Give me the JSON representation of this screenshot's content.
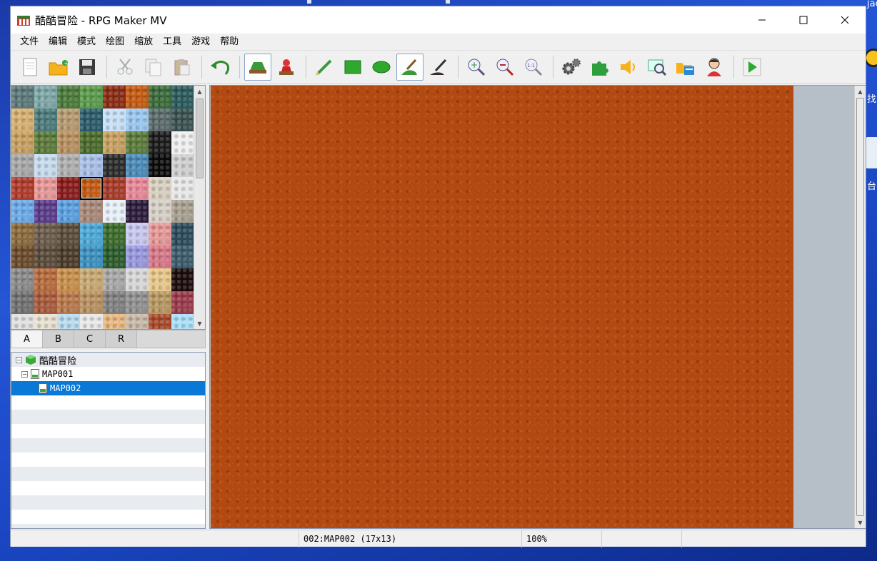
{
  "window": {
    "title": "酷酷冒险 - RPG Maker MV"
  },
  "window_controls": {
    "minimize": "—",
    "maximize": "☐",
    "close": "✕"
  },
  "menu": [
    "文件",
    "编辑",
    "模式",
    "绘图",
    "缩放",
    "工具",
    "游戏",
    "帮助"
  ],
  "toolbar": {
    "buttons": [
      {
        "name": "new-project-icon"
      },
      {
        "name": "open-project-icon"
      },
      {
        "name": "save-project-icon"
      },
      {
        "name": "cut-icon"
      },
      {
        "name": "copy-icon"
      },
      {
        "name": "paste-icon"
      },
      {
        "name": "undo-icon"
      },
      {
        "name": "map-mode-icon",
        "active": true
      },
      {
        "name": "event-mode-icon"
      },
      {
        "name": "pencil-icon"
      },
      {
        "name": "rectangle-icon"
      },
      {
        "name": "ellipse-icon"
      },
      {
        "name": "fill-icon",
        "active": true
      },
      {
        "name": "shadow-pen-icon"
      },
      {
        "name": "zoom-in-icon"
      },
      {
        "name": "zoom-out-icon"
      },
      {
        "name": "zoom-actual-icon"
      },
      {
        "name": "database-icon"
      },
      {
        "name": "plugin-manager-icon"
      },
      {
        "name": "sound-test-icon"
      },
      {
        "name": "event-searcher-icon"
      },
      {
        "name": "resource-manager-icon"
      },
      {
        "name": "character-generator-icon"
      },
      {
        "name": "playtest-icon"
      }
    ]
  },
  "tileset_tabs": [
    "A",
    "B",
    "C",
    "R"
  ],
  "map_tree": {
    "project": "酷酷冒险",
    "maps": [
      {
        "label": "MAP001",
        "level": 1,
        "expanded": true
      },
      {
        "label": "MAP002",
        "level": 2,
        "selected": true
      }
    ]
  },
  "status": {
    "left": "",
    "map_info": "002:MAP002 (17x13)",
    "zoom": "100%"
  },
  "desktop": {
    "frag1": "jac",
    "frag2": "找",
    "frag3": "台"
  },
  "colors": {
    "selection": "#0a78d7",
    "map_fill": "#b04a12"
  }
}
